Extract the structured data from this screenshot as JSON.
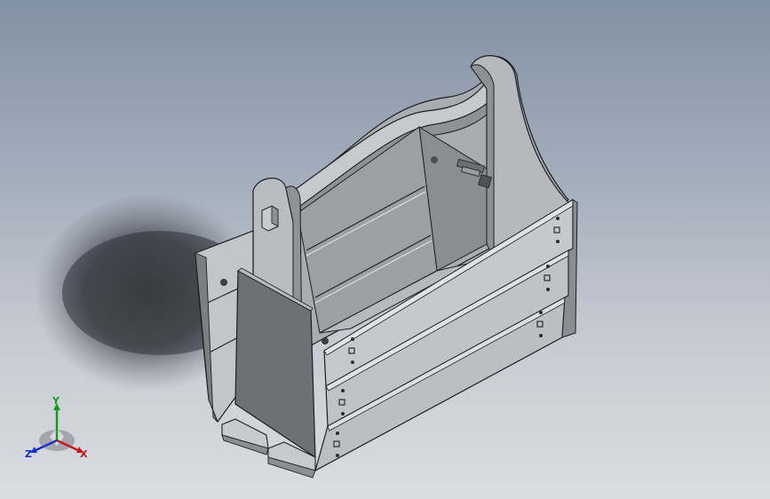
{
  "viewport": {
    "background_top": "#8391a6",
    "background_bottom": "#dadde2"
  },
  "model": {
    "name": "tool-caddy-box",
    "face_light": "#c9cbcf",
    "face_mid": "#a8abb0",
    "face_dark": "#6f7276",
    "face_shadow": "#55585c",
    "edge": "#1e1f21",
    "ground_shadow": "#3b3e44"
  },
  "triad": {
    "x_label": "X",
    "y_label": "Y",
    "z_label": "Z",
    "x_color": "#c41a1a",
    "y_color": "#1a9b1a",
    "z_color": "#1a2fc4"
  }
}
